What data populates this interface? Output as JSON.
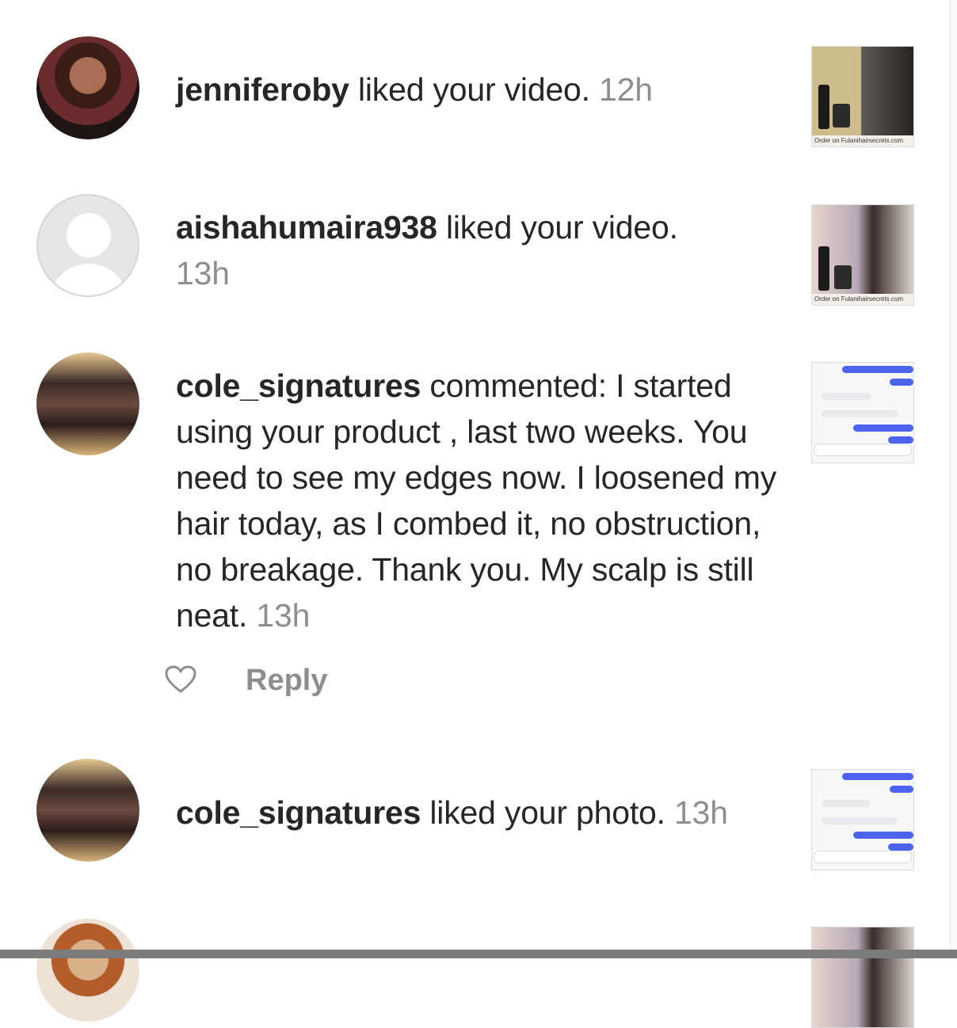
{
  "notifications": [
    {
      "username": "jenniferoby",
      "action": " liked your video.",
      "time": "12h",
      "thumbnail_caption": "Order on Fulanihairsecrets.com",
      "avatar": "profile-photo"
    },
    {
      "username": "aishahumaira938",
      "action": " liked your video.",
      "time": "13h",
      "thumbnail_caption": "Order on Fulanihairsecrets.com",
      "avatar": "default-avatar"
    },
    {
      "username": "cole_signatures",
      "action": " commented: I started using your product , last two weeks. You need to see my edges now. I loosened my hair today, as I combed it, no obstruction, no breakage. Thank you. My scalp is still neat.",
      "time": "13h",
      "reply_label": "Reply",
      "avatar": "profile-photo"
    },
    {
      "username": "cole_signatures",
      "action": " liked your photo.",
      "time": "13h",
      "avatar": "profile-photo"
    }
  ],
  "icons": {
    "like": "heart-icon"
  }
}
